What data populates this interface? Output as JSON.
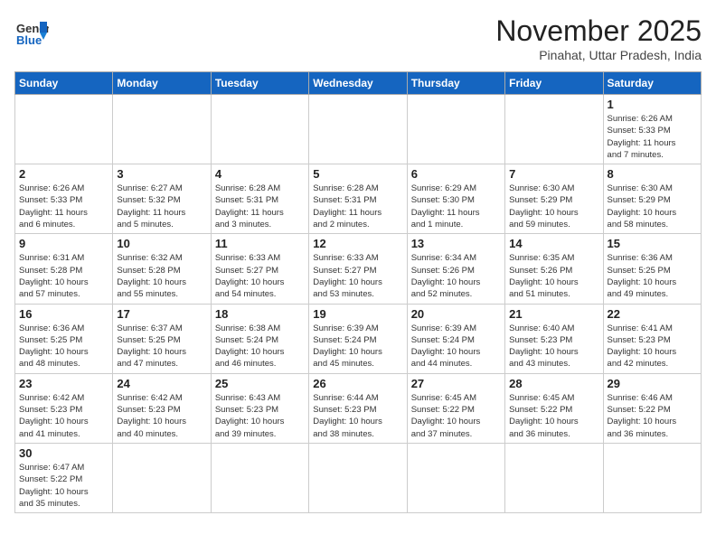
{
  "header": {
    "logo_general": "General",
    "logo_blue": "Blue",
    "month_title": "November 2025",
    "subtitle": "Pinahat, Uttar Pradesh, India"
  },
  "weekdays": [
    "Sunday",
    "Monday",
    "Tuesday",
    "Wednesday",
    "Thursday",
    "Friday",
    "Saturday"
  ],
  "weeks": [
    [
      {
        "day": "",
        "info": ""
      },
      {
        "day": "",
        "info": ""
      },
      {
        "day": "",
        "info": ""
      },
      {
        "day": "",
        "info": ""
      },
      {
        "day": "",
        "info": ""
      },
      {
        "day": "",
        "info": ""
      },
      {
        "day": "1",
        "info": "Sunrise: 6:26 AM\nSunset: 5:33 PM\nDaylight: 11 hours\nand 7 minutes."
      }
    ],
    [
      {
        "day": "2",
        "info": "Sunrise: 6:26 AM\nSunset: 5:33 PM\nDaylight: 11 hours\nand 6 minutes."
      },
      {
        "day": "3",
        "info": "Sunrise: 6:27 AM\nSunset: 5:32 PM\nDaylight: 11 hours\nand 5 minutes."
      },
      {
        "day": "4",
        "info": "Sunrise: 6:28 AM\nSunset: 5:31 PM\nDaylight: 11 hours\nand 3 minutes."
      },
      {
        "day": "5",
        "info": "Sunrise: 6:28 AM\nSunset: 5:31 PM\nDaylight: 11 hours\nand 2 minutes."
      },
      {
        "day": "6",
        "info": "Sunrise: 6:29 AM\nSunset: 5:30 PM\nDaylight: 11 hours\nand 1 minute."
      },
      {
        "day": "7",
        "info": "Sunrise: 6:30 AM\nSunset: 5:29 PM\nDaylight: 10 hours\nand 59 minutes."
      },
      {
        "day": "8",
        "info": "Sunrise: 6:30 AM\nSunset: 5:29 PM\nDaylight: 10 hours\nand 58 minutes."
      }
    ],
    [
      {
        "day": "9",
        "info": "Sunrise: 6:31 AM\nSunset: 5:28 PM\nDaylight: 10 hours\nand 57 minutes."
      },
      {
        "day": "10",
        "info": "Sunrise: 6:32 AM\nSunset: 5:28 PM\nDaylight: 10 hours\nand 55 minutes."
      },
      {
        "day": "11",
        "info": "Sunrise: 6:33 AM\nSunset: 5:27 PM\nDaylight: 10 hours\nand 54 minutes."
      },
      {
        "day": "12",
        "info": "Sunrise: 6:33 AM\nSunset: 5:27 PM\nDaylight: 10 hours\nand 53 minutes."
      },
      {
        "day": "13",
        "info": "Sunrise: 6:34 AM\nSunset: 5:26 PM\nDaylight: 10 hours\nand 52 minutes."
      },
      {
        "day": "14",
        "info": "Sunrise: 6:35 AM\nSunset: 5:26 PM\nDaylight: 10 hours\nand 51 minutes."
      },
      {
        "day": "15",
        "info": "Sunrise: 6:36 AM\nSunset: 5:25 PM\nDaylight: 10 hours\nand 49 minutes."
      }
    ],
    [
      {
        "day": "16",
        "info": "Sunrise: 6:36 AM\nSunset: 5:25 PM\nDaylight: 10 hours\nand 48 minutes."
      },
      {
        "day": "17",
        "info": "Sunrise: 6:37 AM\nSunset: 5:25 PM\nDaylight: 10 hours\nand 47 minutes."
      },
      {
        "day": "18",
        "info": "Sunrise: 6:38 AM\nSunset: 5:24 PM\nDaylight: 10 hours\nand 46 minutes."
      },
      {
        "day": "19",
        "info": "Sunrise: 6:39 AM\nSunset: 5:24 PM\nDaylight: 10 hours\nand 45 minutes."
      },
      {
        "day": "20",
        "info": "Sunrise: 6:39 AM\nSunset: 5:24 PM\nDaylight: 10 hours\nand 44 minutes."
      },
      {
        "day": "21",
        "info": "Sunrise: 6:40 AM\nSunset: 5:23 PM\nDaylight: 10 hours\nand 43 minutes."
      },
      {
        "day": "22",
        "info": "Sunrise: 6:41 AM\nSunset: 5:23 PM\nDaylight: 10 hours\nand 42 minutes."
      }
    ],
    [
      {
        "day": "23",
        "info": "Sunrise: 6:42 AM\nSunset: 5:23 PM\nDaylight: 10 hours\nand 41 minutes."
      },
      {
        "day": "24",
        "info": "Sunrise: 6:42 AM\nSunset: 5:23 PM\nDaylight: 10 hours\nand 40 minutes."
      },
      {
        "day": "25",
        "info": "Sunrise: 6:43 AM\nSunset: 5:23 PM\nDaylight: 10 hours\nand 39 minutes."
      },
      {
        "day": "26",
        "info": "Sunrise: 6:44 AM\nSunset: 5:23 PM\nDaylight: 10 hours\nand 38 minutes."
      },
      {
        "day": "27",
        "info": "Sunrise: 6:45 AM\nSunset: 5:22 PM\nDaylight: 10 hours\nand 37 minutes."
      },
      {
        "day": "28",
        "info": "Sunrise: 6:45 AM\nSunset: 5:22 PM\nDaylight: 10 hours\nand 36 minutes."
      },
      {
        "day": "29",
        "info": "Sunrise: 6:46 AM\nSunset: 5:22 PM\nDaylight: 10 hours\nand 36 minutes."
      }
    ],
    [
      {
        "day": "30",
        "info": "Sunrise: 6:47 AM\nSunset: 5:22 PM\nDaylight: 10 hours\nand 35 minutes."
      },
      {
        "day": "",
        "info": ""
      },
      {
        "day": "",
        "info": ""
      },
      {
        "day": "",
        "info": ""
      },
      {
        "day": "",
        "info": ""
      },
      {
        "day": "",
        "info": ""
      },
      {
        "day": "",
        "info": ""
      }
    ]
  ]
}
